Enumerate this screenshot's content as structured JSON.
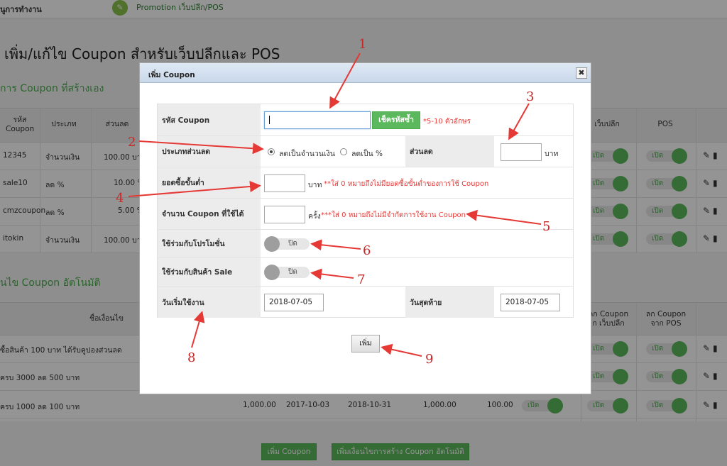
{
  "topbar": {
    "menu_label": "นูการทำงาน",
    "promo_label": "Promotion เว็บปลีก/POS"
  },
  "page": {
    "title": "เพิ่ม/แก้ไข Coupon สำหรับเว็บปลีกและ POS",
    "section1_title": "การ Coupon ที่สร้างเอง",
    "section2_title": "นไข Coupon อัตโนมัติ"
  },
  "table1": {
    "headers": {
      "code": "รหัส Coupon",
      "type": "ประเภท",
      "discount": "ส่วนลด",
      "web": "เว็บปลีก",
      "pos": "POS"
    },
    "rows": [
      {
        "code": "12345",
        "type": "จำนวนเงิน",
        "discount": "100.00 บา",
        "web_toggle": "เปิด",
        "pos_toggle": "เปิด"
      },
      {
        "code": "sale10",
        "type": "ลด %",
        "discount": "10.00 %",
        "web_toggle": "เปิด",
        "pos_toggle": "เปิด"
      },
      {
        "code": "cmzcoupon",
        "type": "ลด %",
        "discount": "5.00 %",
        "web_toggle": "เปิด",
        "pos_toggle": "เปิด"
      },
      {
        "code": "itokin",
        "type": "จำนวนเงิน",
        "discount": "100.00 บา",
        "web_toggle": "เปิด",
        "pos_toggle": "เปิด"
      }
    ]
  },
  "table2": {
    "headers": {
      "condition": "ชื่อเงื่อนไข",
      "web": "ลก Coupon\nก เว็บปลีก",
      "pos": "ลก Coupon\nจาก POS"
    },
    "rows": [
      {
        "condition": "ซื้อสินค้า 100 บาท ได้รับคูปองส่วนลด",
        "web_toggle": "เปิด",
        "pos_toggle": "เปิด"
      },
      {
        "condition": "ครบ 3000 ลด 500 บาท",
        "web_toggle": "เปิด",
        "pos_toggle": "เปิด"
      },
      {
        "condition": "ครบ 1000 ลด 100 บาท",
        "min": "1,000.00",
        "start": "2017-10-03",
        "end": "2018-10-31",
        "amount": "1,000.00",
        "discount": "100.00",
        "flag_toggle": "เปิด",
        "web_toggle": "เปิด",
        "pos_toggle": "เปิด"
      }
    ]
  },
  "footer": {
    "add_coupon": "เพิ่ม Coupon",
    "add_auto": "เพิ่มเงื่อนไขการสร้าง Coupon อัตโนมัติ"
  },
  "dialog": {
    "title": "เพิ่ม Coupon",
    "close_glyph": "✖",
    "code_label": "รหัส Coupon",
    "code_value": "",
    "check_button": "เช็ครหัสซ้ำ",
    "code_hint": "*5-10 ตัวอักษร",
    "type_label": "ประเภทส่วนลด",
    "type_option_amount": "ลดเป็นจำนวนเงิน",
    "type_option_percent": "ลดเป็น %",
    "type_selected": "amount",
    "discount_label": "ส่วนลด",
    "discount_value": "",
    "discount_unit": "บาท",
    "min_label": "ยอดซื้อขั้นต่ำ",
    "min_value": "",
    "min_unit": "บาท",
    "min_hint": "**ใส่ 0 หมายถึงไม่มียอดซื้อขั้นต่ำของการใช้ Coupon",
    "count_label": "จำนวน Coupon ที่ใช้ได้",
    "count_value": "",
    "count_unit": "ครั้ง",
    "count_hint": "***ใส่ 0 หมายถึงไม่มีจำกัดการใช้งาน Coupon",
    "promo_label": "ใช้ร่วมกับโปรโมชั่น",
    "promo_toggle": "ปิด",
    "sale_label": "ใช้ร่วมกับสินค้า Sale",
    "sale_toggle": "ปิด",
    "start_label": "วันเริ่มใช้งาน",
    "start_value": "2018-07-05",
    "end_label": "วันสุดท้าย",
    "end_value": "2018-07-05",
    "submit_button": "เพิ่ม"
  },
  "annotations": [
    "1",
    "2",
    "3",
    "4",
    "5",
    "6",
    "7",
    "8",
    "9"
  ],
  "colors": {
    "accent_green": "#5cb85c",
    "hint_red": "#e53935",
    "annotation_red": "#c62828"
  }
}
